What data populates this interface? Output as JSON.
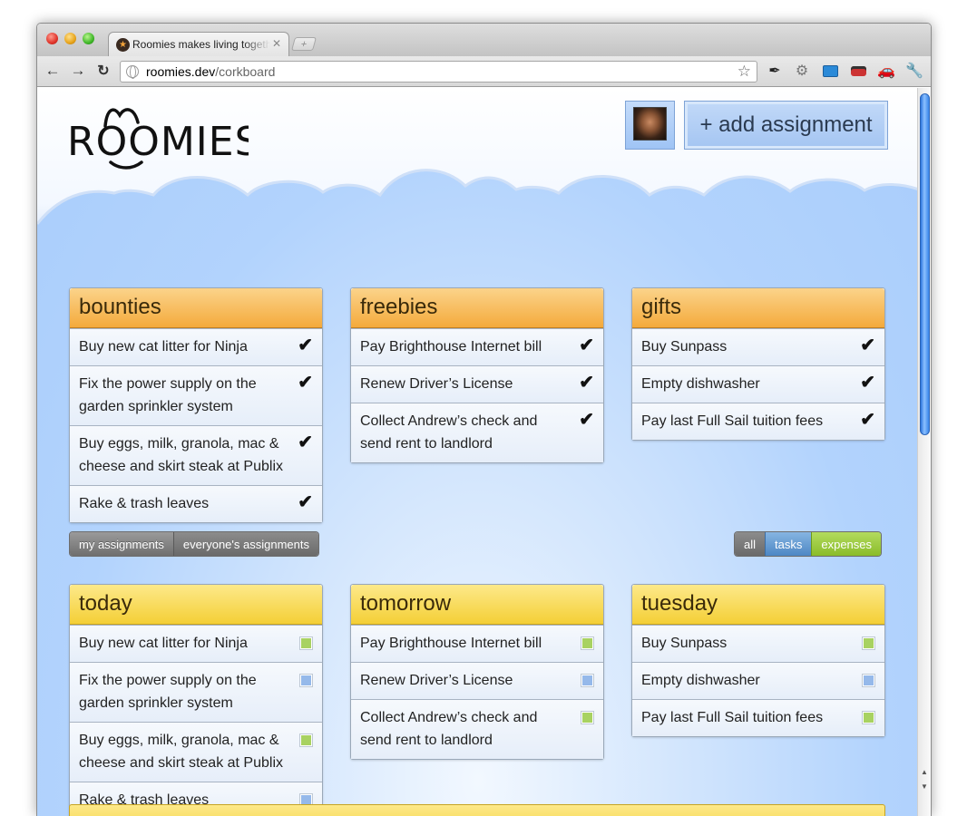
{
  "browser": {
    "tab_title": "Roomies makes living together",
    "tab_favicon": "★",
    "url_host": "roomies.dev",
    "url_path": "/corkboard"
  },
  "header": {
    "logo_text": "ROOMIES",
    "add_button": "+ add assignment"
  },
  "colors": {
    "accent_green": "#a8d261",
    "accent_blue": "#95b9ea",
    "orange_header": "#f4aa3c",
    "yellow_header": "#f4cf36"
  },
  "top_cards": [
    {
      "title": "bounties",
      "items": [
        "Buy new cat litter for Ninja",
        "Fix the power supply on the garden sprinkler system",
        "Buy eggs, milk, granola, mac & cheese and skirt steak at Publix",
        "Rake & trash leaves"
      ]
    },
    {
      "title": "freebies",
      "items": [
        "Pay Brighthouse Internet bill",
        "Renew Driver’s License",
        "Collect Andrew’s check and send rent to landlord"
      ]
    },
    {
      "title": "gifts",
      "items": [
        "Buy Sunpass",
        "Empty dishwasher",
        "Pay last Full Sail tuition fees"
      ]
    }
  ],
  "filters": {
    "scope": [
      "my assignments",
      "everyone's assignments"
    ],
    "type": [
      "all",
      "tasks",
      "expenses"
    ]
  },
  "day_cards": [
    {
      "title": "today",
      "items": [
        {
          "text": "Buy new cat litter for Ninja",
          "kind": "expense"
        },
        {
          "text": "Fix the power supply on the garden sprinkler system",
          "kind": "task"
        },
        {
          "text": "Buy eggs, milk, granola, mac & cheese and skirt steak at Publix",
          "kind": "expense"
        },
        {
          "text": "Rake & trash leaves",
          "kind": "task"
        }
      ]
    },
    {
      "title": "tomorrow",
      "items": [
        {
          "text": "Pay Brighthouse Internet bill",
          "kind": "expense"
        },
        {
          "text": "Renew Driver’s License",
          "kind": "task"
        },
        {
          "text": "Collect Andrew’s check and send rent to landlord",
          "kind": "expense"
        }
      ]
    },
    {
      "title": "tuesday",
      "items": [
        {
          "text": "Buy Sunpass",
          "kind": "expense"
        },
        {
          "text": "Empty dishwasher",
          "kind": "task"
        },
        {
          "text": "Pay last Full Sail tuition fees",
          "kind": "expense"
        }
      ]
    }
  ]
}
